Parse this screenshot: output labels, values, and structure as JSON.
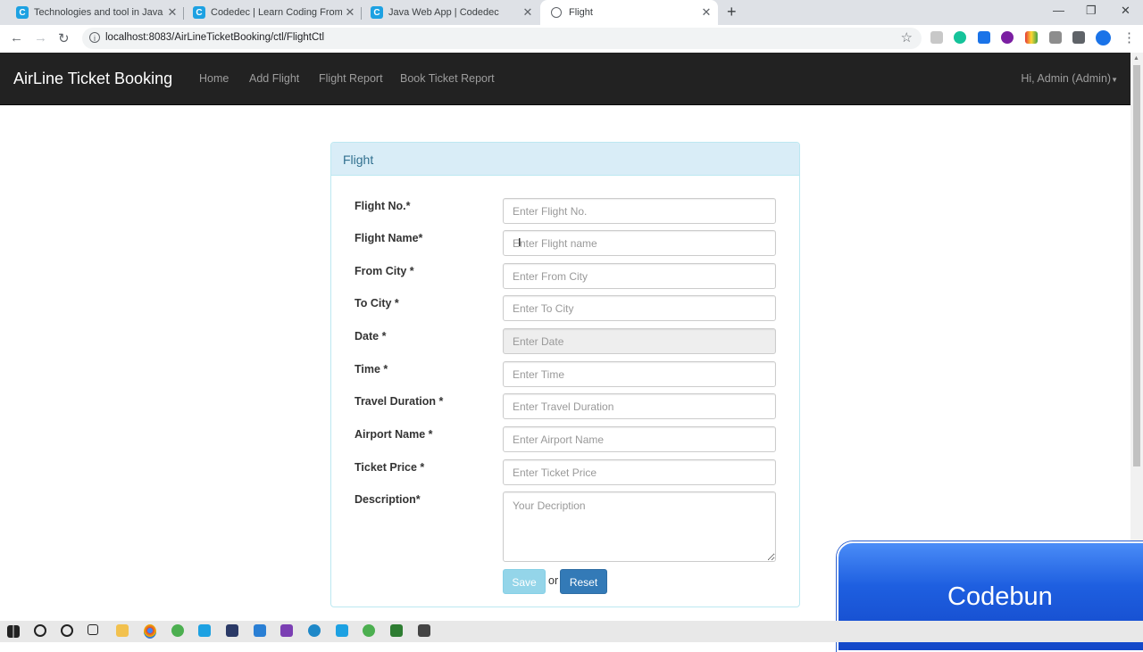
{
  "browser": {
    "tabs": [
      {
        "title": "Technologies and tool in Java we",
        "icon": "C"
      },
      {
        "title": "Codedec | Learn Coding From Th",
        "icon": "C"
      },
      {
        "title": "Java Web App | Codedec",
        "icon": "C"
      },
      {
        "title": "Flight",
        "icon": "globe"
      }
    ],
    "new_tab": "+",
    "url": "localhost:8083/AirLineTicketBooking/ctl/FlightCtl"
  },
  "navbar": {
    "brand": "AirLine Ticket Booking",
    "links": [
      "Home",
      "Add Flight",
      "Flight Report",
      "Book Ticket Report"
    ],
    "user": "Hi, Admin (Admin)"
  },
  "panel": {
    "heading": "Flight",
    "fields": [
      {
        "label": "Flight No.*",
        "placeholder": "Enter Flight No."
      },
      {
        "label": "Flight Name*",
        "placeholder": "Enter Flight name"
      },
      {
        "label": "From City *",
        "placeholder": "Enter From City"
      },
      {
        "label": "To City *",
        "placeholder": "Enter To City"
      },
      {
        "label": "Date *",
        "placeholder": "Enter Date"
      },
      {
        "label": "Time *",
        "placeholder": "Enter Time"
      },
      {
        "label": "Travel Duration *",
        "placeholder": "Enter Travel Duration"
      },
      {
        "label": "Airport Name *",
        "placeholder": "Enter Airport Name"
      },
      {
        "label": "Ticket Price *",
        "placeholder": "Enter Ticket Price"
      },
      {
        "label": "Description*",
        "placeholder": "Your Decription"
      }
    ],
    "save_label": "Save",
    "or_label": "or",
    "reset_label": "Reset"
  },
  "watermark": "Codebun",
  "colors": {
    "navbar": "#222222",
    "panel_heading": "#d9edf7",
    "save": "#5bc0de",
    "reset": "#337ab7"
  }
}
